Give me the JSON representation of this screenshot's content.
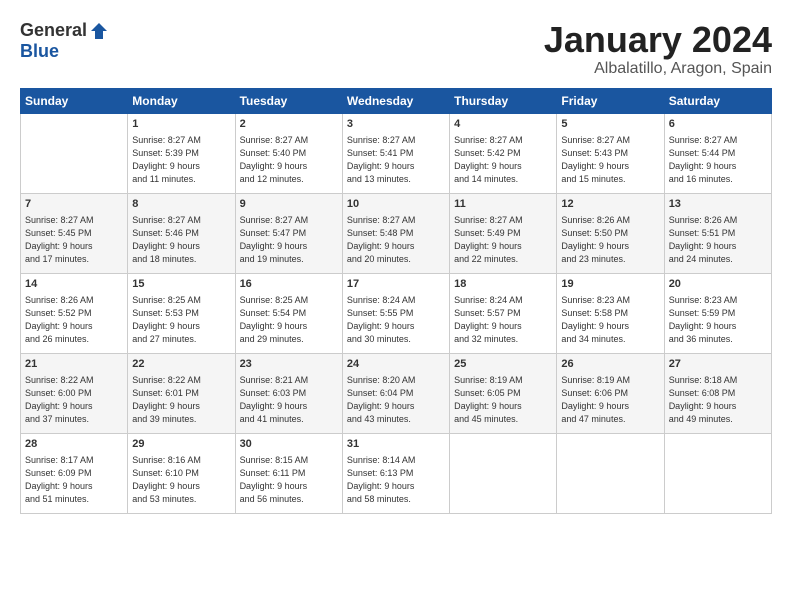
{
  "logo": {
    "general": "General",
    "blue": "Blue"
  },
  "header": {
    "title": "January 2024",
    "location": "Albalatillo, Aragon, Spain"
  },
  "weekdays": [
    "Sunday",
    "Monday",
    "Tuesday",
    "Wednesday",
    "Thursday",
    "Friday",
    "Saturday"
  ],
  "weeks": [
    [
      {
        "day": "",
        "info": ""
      },
      {
        "day": "1",
        "info": "Sunrise: 8:27 AM\nSunset: 5:39 PM\nDaylight: 9 hours\nand 11 minutes."
      },
      {
        "day": "2",
        "info": "Sunrise: 8:27 AM\nSunset: 5:40 PM\nDaylight: 9 hours\nand 12 minutes."
      },
      {
        "day": "3",
        "info": "Sunrise: 8:27 AM\nSunset: 5:41 PM\nDaylight: 9 hours\nand 13 minutes."
      },
      {
        "day": "4",
        "info": "Sunrise: 8:27 AM\nSunset: 5:42 PM\nDaylight: 9 hours\nand 14 minutes."
      },
      {
        "day": "5",
        "info": "Sunrise: 8:27 AM\nSunset: 5:43 PM\nDaylight: 9 hours\nand 15 minutes."
      },
      {
        "day": "6",
        "info": "Sunrise: 8:27 AM\nSunset: 5:44 PM\nDaylight: 9 hours\nand 16 minutes."
      }
    ],
    [
      {
        "day": "7",
        "info": "Sunrise: 8:27 AM\nSunset: 5:45 PM\nDaylight: 9 hours\nand 17 minutes."
      },
      {
        "day": "8",
        "info": "Sunrise: 8:27 AM\nSunset: 5:46 PM\nDaylight: 9 hours\nand 18 minutes."
      },
      {
        "day": "9",
        "info": "Sunrise: 8:27 AM\nSunset: 5:47 PM\nDaylight: 9 hours\nand 19 minutes."
      },
      {
        "day": "10",
        "info": "Sunrise: 8:27 AM\nSunset: 5:48 PM\nDaylight: 9 hours\nand 20 minutes."
      },
      {
        "day": "11",
        "info": "Sunrise: 8:27 AM\nSunset: 5:49 PM\nDaylight: 9 hours\nand 22 minutes."
      },
      {
        "day": "12",
        "info": "Sunrise: 8:26 AM\nSunset: 5:50 PM\nDaylight: 9 hours\nand 23 minutes."
      },
      {
        "day": "13",
        "info": "Sunrise: 8:26 AM\nSunset: 5:51 PM\nDaylight: 9 hours\nand 24 minutes."
      }
    ],
    [
      {
        "day": "14",
        "info": "Sunrise: 8:26 AM\nSunset: 5:52 PM\nDaylight: 9 hours\nand 26 minutes."
      },
      {
        "day": "15",
        "info": "Sunrise: 8:25 AM\nSunset: 5:53 PM\nDaylight: 9 hours\nand 27 minutes."
      },
      {
        "day": "16",
        "info": "Sunrise: 8:25 AM\nSunset: 5:54 PM\nDaylight: 9 hours\nand 29 minutes."
      },
      {
        "day": "17",
        "info": "Sunrise: 8:24 AM\nSunset: 5:55 PM\nDaylight: 9 hours\nand 30 minutes."
      },
      {
        "day": "18",
        "info": "Sunrise: 8:24 AM\nSunset: 5:57 PM\nDaylight: 9 hours\nand 32 minutes."
      },
      {
        "day": "19",
        "info": "Sunrise: 8:23 AM\nSunset: 5:58 PM\nDaylight: 9 hours\nand 34 minutes."
      },
      {
        "day": "20",
        "info": "Sunrise: 8:23 AM\nSunset: 5:59 PM\nDaylight: 9 hours\nand 36 minutes."
      }
    ],
    [
      {
        "day": "21",
        "info": "Sunrise: 8:22 AM\nSunset: 6:00 PM\nDaylight: 9 hours\nand 37 minutes."
      },
      {
        "day": "22",
        "info": "Sunrise: 8:22 AM\nSunset: 6:01 PM\nDaylight: 9 hours\nand 39 minutes."
      },
      {
        "day": "23",
        "info": "Sunrise: 8:21 AM\nSunset: 6:03 PM\nDaylight: 9 hours\nand 41 minutes."
      },
      {
        "day": "24",
        "info": "Sunrise: 8:20 AM\nSunset: 6:04 PM\nDaylight: 9 hours\nand 43 minutes."
      },
      {
        "day": "25",
        "info": "Sunrise: 8:19 AM\nSunset: 6:05 PM\nDaylight: 9 hours\nand 45 minutes."
      },
      {
        "day": "26",
        "info": "Sunrise: 8:19 AM\nSunset: 6:06 PM\nDaylight: 9 hours\nand 47 minutes."
      },
      {
        "day": "27",
        "info": "Sunrise: 8:18 AM\nSunset: 6:08 PM\nDaylight: 9 hours\nand 49 minutes."
      }
    ],
    [
      {
        "day": "28",
        "info": "Sunrise: 8:17 AM\nSunset: 6:09 PM\nDaylight: 9 hours\nand 51 minutes."
      },
      {
        "day": "29",
        "info": "Sunrise: 8:16 AM\nSunset: 6:10 PM\nDaylight: 9 hours\nand 53 minutes."
      },
      {
        "day": "30",
        "info": "Sunrise: 8:15 AM\nSunset: 6:11 PM\nDaylight: 9 hours\nand 56 minutes."
      },
      {
        "day": "31",
        "info": "Sunrise: 8:14 AM\nSunset: 6:13 PM\nDaylight: 9 hours\nand 58 minutes."
      },
      {
        "day": "",
        "info": ""
      },
      {
        "day": "",
        "info": ""
      },
      {
        "day": "",
        "info": ""
      }
    ]
  ]
}
